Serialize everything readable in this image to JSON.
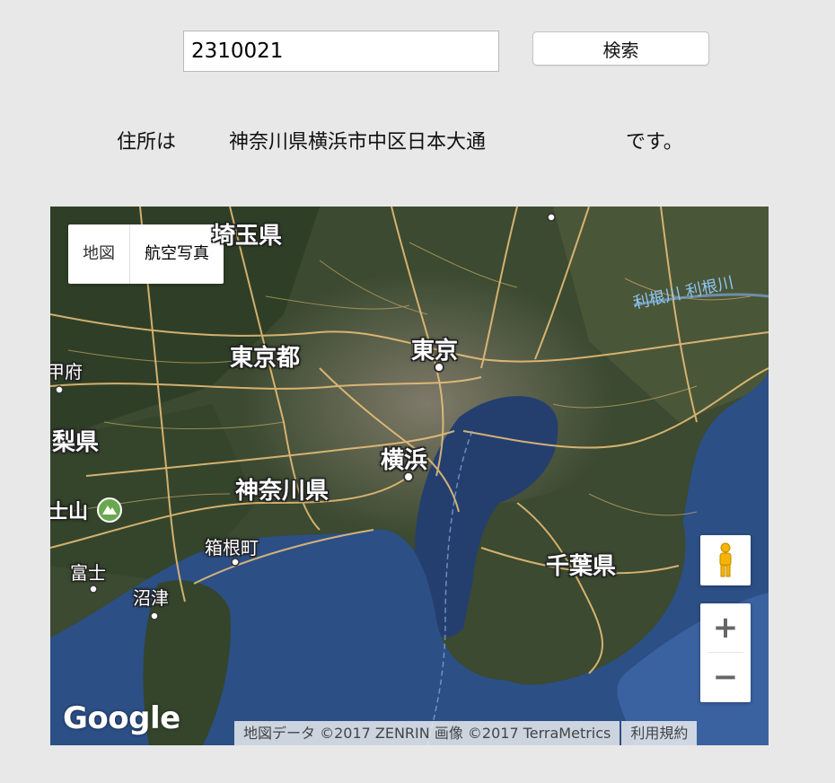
{
  "search": {
    "zip_value": "2310021",
    "button_label": "検索"
  },
  "address": {
    "prefix": "住所は",
    "value": "神奈川県横浜市中区日本大通",
    "suffix": "です。"
  },
  "map": {
    "map_types": [
      "地図",
      "航空写真"
    ],
    "selected_map_type": "航空写真",
    "zoom_in": "+",
    "zoom_out": "−",
    "logo": "Google",
    "attribution": "地図データ ©2017 ZENRIN 画像 ©2017 TerraMetrics",
    "terms": "利用規約",
    "labels": {
      "saitama": "埼玉県",
      "tokyo_to": "東京都",
      "tokyo": "東京",
      "kofu": "甲府",
      "yamanashi": "梨県",
      "yokohama": "横浜",
      "kanagawa": "神奈川県",
      "fuji_san": "士山",
      "hakone": "箱根町",
      "fuji": "富士",
      "numazu": "沼津",
      "chiba": "千葉県",
      "tone_river": "利根川 利根川"
    },
    "colors": {
      "land": "#3b4a30",
      "sea": "#2c4f86",
      "roads": "#f0c37a"
    }
  }
}
